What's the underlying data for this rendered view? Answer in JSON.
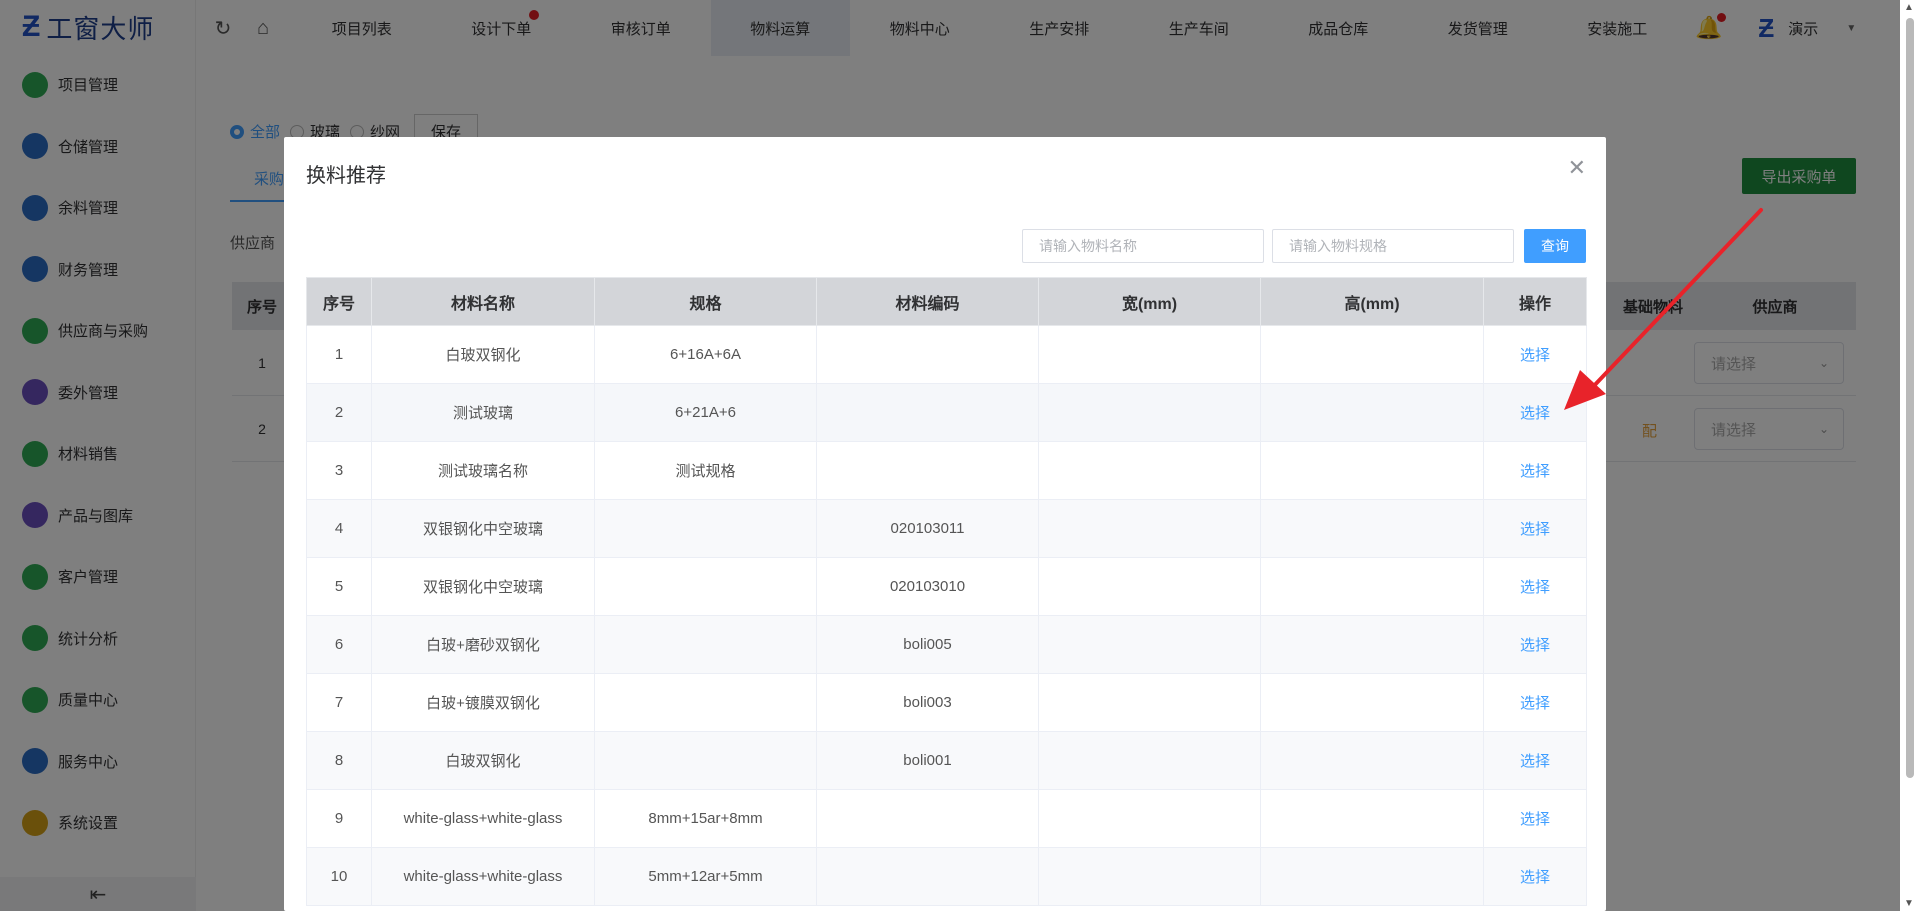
{
  "app": {
    "logo_text": "工窗大师",
    "user_name": "演示"
  },
  "sidebar": {
    "items": [
      {
        "label": "项目管理",
        "color": "#2eaa55"
      },
      {
        "label": "仓储管理",
        "color": "#2b6cc4"
      },
      {
        "label": "余料管理",
        "color": "#2b6cc4"
      },
      {
        "label": "财务管理",
        "color": "#2b6cc4"
      },
      {
        "label": "供应商与采购",
        "color": "#2eaa55"
      },
      {
        "label": "委外管理",
        "color": "#6b4fbf"
      },
      {
        "label": "材料销售",
        "color": "#2eaa55"
      },
      {
        "label": "产品与图库",
        "color": "#6b4fbf"
      },
      {
        "label": "客户管理",
        "color": "#2eaa55"
      },
      {
        "label": "统计分析",
        "color": "#2eaa55"
      },
      {
        "label": "质量中心",
        "color": "#2eaa55"
      },
      {
        "label": "服务中心",
        "color": "#2b6cc4"
      },
      {
        "label": "系统设置",
        "color": "#d4a017"
      }
    ]
  },
  "topnav": {
    "menu": [
      {
        "label": "项目列表",
        "dot": false,
        "active": false
      },
      {
        "label": "设计下单",
        "dot": true,
        "active": false
      },
      {
        "label": "审核订单",
        "dot": false,
        "active": false
      },
      {
        "label": "物料运算",
        "dot": false,
        "active": true
      },
      {
        "label": "物料中心",
        "dot": false,
        "active": false
      },
      {
        "label": "生产安排",
        "dot": false,
        "active": false
      },
      {
        "label": "生产车间",
        "dot": false,
        "active": false
      },
      {
        "label": "成品仓库",
        "dot": false,
        "active": false
      },
      {
        "label": "发货管理",
        "dot": false,
        "active": false
      },
      {
        "label": "安装施工",
        "dot": false,
        "active": false
      }
    ]
  },
  "page": {
    "filter": {
      "all": "全部",
      "glass": "玻璃",
      "screen": "纱网",
      "save": "保存"
    },
    "tab_partial": "采购",
    "supplier_label": "供应商",
    "export_button": "导出采购单",
    "table_head": {
      "seq": "序号",
      "base": "基础物料",
      "supplier": "供应商"
    },
    "rows": [
      {
        "seq": "1",
        "select": "请选择",
        "tag": ""
      },
      {
        "seq": "2",
        "select": "请选择",
        "tag": "配"
      }
    ]
  },
  "modal": {
    "title": "换料推荐",
    "name_placeholder": "请输入物料名称",
    "spec_placeholder": "请输入物料规格",
    "query_button": "查询",
    "columns": [
      "序号",
      "材料名称",
      "规格",
      "材料编码",
      "宽(mm)",
      "高(mm)",
      "操作"
    ],
    "rows": [
      {
        "seq": "1",
        "name": "白玻双钢化",
        "spec": "6+16A+6A",
        "code": "",
        "width": "",
        "height": "",
        "op": "选择"
      },
      {
        "seq": "2",
        "name": "测试玻璃",
        "spec": "6+21A+6",
        "code": "",
        "width": "",
        "height": "",
        "op": "选择"
      },
      {
        "seq": "3",
        "name": "测试玻璃名称",
        "spec": "测试规格",
        "code": "",
        "width": "",
        "height": "",
        "op": "选择"
      },
      {
        "seq": "4",
        "name": "双银钢化中空玻璃",
        "spec": "",
        "code": "020103011",
        "width": "",
        "height": "",
        "op": "选择"
      },
      {
        "seq": "5",
        "name": "双银钢化中空玻璃",
        "spec": "",
        "code": "020103010",
        "width": "",
        "height": "",
        "op": "选择"
      },
      {
        "seq": "6",
        "name": "白玻+磨砂双钢化",
        "spec": "",
        "code": "boli005",
        "width": "",
        "height": "",
        "op": "选择"
      },
      {
        "seq": "7",
        "name": "白玻+镀膜双钢化",
        "spec": "",
        "code": "boli003",
        "width": "",
        "height": "",
        "op": "选择"
      },
      {
        "seq": "8",
        "name": "白玻双钢化",
        "spec": "",
        "code": "boli001",
        "width": "",
        "height": "",
        "op": "选择"
      },
      {
        "seq": "9",
        "name": "white-glass+white-glass",
        "spec": "8mm+15ar+8mm",
        "code": "",
        "width": "",
        "height": "",
        "op": "选择"
      },
      {
        "seq": "10",
        "name": "white-glass+white-glass",
        "spec": "5mm+12ar+5mm",
        "code": "",
        "width": "",
        "height": "",
        "op": "选择"
      }
    ]
  },
  "colors": {
    "accent": "#409eff",
    "export": "#1e8e3e",
    "annotation": "#e8232a"
  }
}
